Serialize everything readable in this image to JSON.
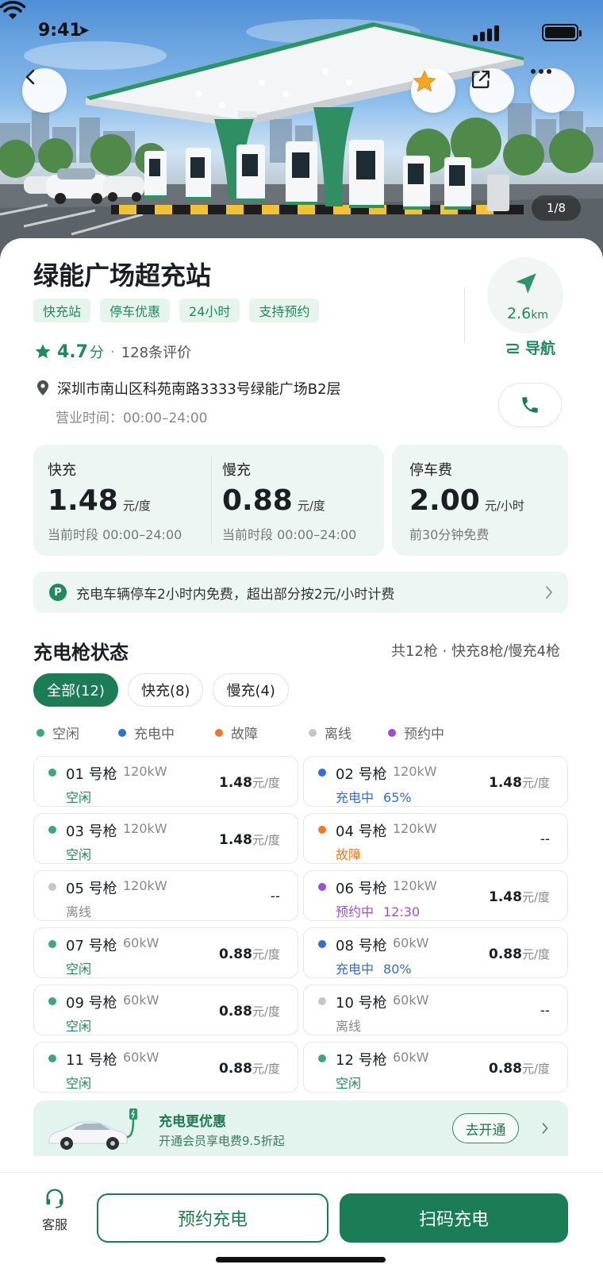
{
  "status_bar": {
    "time": "9:41"
  },
  "hero": {
    "image_counter": "1/8"
  },
  "station": {
    "name": "绿能广场超充站",
    "tags": [
      "快充站",
      "停车优惠",
      "24小时",
      "支持预约"
    ],
    "rating": {
      "score": "4.7",
      "unit": "分",
      "reviews": "128条评价"
    },
    "address": "深圳市南山区科苑南路3333号绿能广场B2层",
    "hours": "营业时间：00:00–24:00",
    "distance": {
      "value": "2.6",
      "unit": "km"
    },
    "nav_label": "导航"
  },
  "prices": [
    {
      "label": "快充",
      "value": "1.48",
      "unit": "元/度",
      "sub": "当前时段 00:00–24:00"
    },
    {
      "label": "慢充",
      "value": "0.88",
      "unit": "元/度",
      "sub": "当前时段 00:00–24:00"
    },
    {
      "label": "停车费",
      "value": "2.00",
      "unit": "元/小时",
      "sub": "前30分钟免费"
    }
  ],
  "parking_notice": {
    "badge": "P",
    "text": "充电车辆停车2小时内免费，超出部分按2元/小时计费"
  },
  "guns_section": {
    "title": "充电枪状态",
    "summary": "共12枪  ·  快充8枪/慢充4枪",
    "filters": [
      "全部(12)",
      "快充(8)",
      "慢充(4)"
    ],
    "legend": [
      {
        "label": "空闲",
        "color": "#3aa87a"
      },
      {
        "label": "充电中",
        "color": "#2f6fd6"
      },
      {
        "label": "故障",
        "color": "#ef7a26"
      },
      {
        "label": "离线",
        "color": "#c4c7ca"
      },
      {
        "label": "预约中",
        "color": "#9a4fd8"
      }
    ],
    "guns": [
      {
        "name": "01 号枪",
        "power": "120kW",
        "status": "空闲",
        "extra": "",
        "price": "1.48",
        "price_unit": "元/度",
        "color": "#3aa87a"
      },
      {
        "name": "02 号枪",
        "power": "120kW",
        "status": "充电中",
        "extra": "65%",
        "price": "1.48",
        "price_unit": "元/度",
        "color": "#2f6fd6"
      },
      {
        "name": "03 号枪",
        "power": "120kW",
        "status": "空闲",
        "extra": "",
        "price": "1.48",
        "price_unit": "元/度",
        "color": "#3aa87a"
      },
      {
        "name": "04 号枪",
        "power": "120kW",
        "status": "故障",
        "extra": "",
        "price": "--",
        "price_unit": "",
        "color": "#ef7a26"
      },
      {
        "name": "05 号枪",
        "power": "120kW",
        "status": "离线",
        "extra": "",
        "price": "--",
        "price_unit": "",
        "color": "#c4c7ca"
      },
      {
        "name": "06 号枪",
        "power": "120kW",
        "status": "预约中",
        "extra": "12:30",
        "price": "1.48",
        "price_unit": "元/度",
        "color": "#9a4fd8"
      },
      {
        "name": "07 号枪",
        "power": "60kW",
        "status": "空闲",
        "extra": "",
        "price": "0.88",
        "price_unit": "元/度",
        "color": "#3aa87a"
      },
      {
        "name": "08 号枪",
        "power": "60kW",
        "status": "充电中",
        "extra": "80%",
        "price": "0.88",
        "price_unit": "元/度",
        "color": "#2f6fd6"
      },
      {
        "name": "09 号枪",
        "power": "60kW",
        "status": "空闲",
        "extra": "",
        "price": "0.88",
        "price_unit": "元/度",
        "color": "#3aa87a"
      },
      {
        "name": "10 号枪",
        "power": "60kW",
        "status": "离线",
        "extra": "",
        "price": "--",
        "price_unit": "",
        "color": "#c4c7ca"
      },
      {
        "name": "11 号枪",
        "power": "60kW",
        "status": "空闲",
        "extra": "",
        "price": "0.88",
        "price_unit": "元/度",
        "color": "#3aa87a"
      },
      {
        "name": "12 号枪",
        "power": "60kW",
        "status": "空闲",
        "extra": "",
        "price": "0.88",
        "price_unit": "元/度",
        "color": "#3aa87a"
      }
    ]
  },
  "promo": {
    "title": "充电更优惠",
    "subtitle": "开通会员享电费9.5折起",
    "button": "去开通"
  },
  "bottom_bar": {
    "service": "客服",
    "reserve": "预约充电",
    "scan": "扫码充电"
  },
  "colors": {
    "brand": "#1b7d56",
    "brand_light": "#eef6f4",
    "star": "#f5a623"
  }
}
